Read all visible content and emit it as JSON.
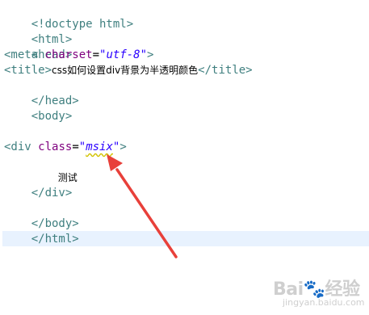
{
  "editor": {
    "lines": {
      "l1": {
        "tag": "<!doctype html>"
      },
      "l2": {
        "tag": "<html>"
      },
      "l3": {
        "tag": "<head>"
      },
      "l4": {
        "open": "<meta ",
        "attr": "charset",
        "eq": "=",
        "value": "\"utf-8\"",
        "close": ">"
      },
      "l5": {
        "open": "<title>",
        "text": "css如何设置div背景为半透明颜色",
        "close": "</title>"
      },
      "l6": {
        "tag": "</head>"
      },
      "l7": {
        "tag": "<body>"
      },
      "l10": {
        "open": "<div ",
        "attr": "class",
        "eq": "=",
        "value_q1": "\"",
        "value_word": "msix",
        "value_q2": "\"",
        "close": ">"
      },
      "l11": {
        "text": "测试"
      },
      "l12": {
        "tag": "</div>"
      },
      "l14": {
        "tag": "</body>"
      },
      "l15": {
        "tag": "</html>"
      }
    }
  },
  "annotation": {
    "arrow_color": "#e8403a"
  },
  "watermark": {
    "main": "Bai🐾经验",
    "sub": "jingyan.baidu.com"
  },
  "colors": {
    "tag": "#3f7f7f",
    "attribute": "#7f007f",
    "value": "#2a00ff",
    "current_line": "#e8f2fe"
  }
}
